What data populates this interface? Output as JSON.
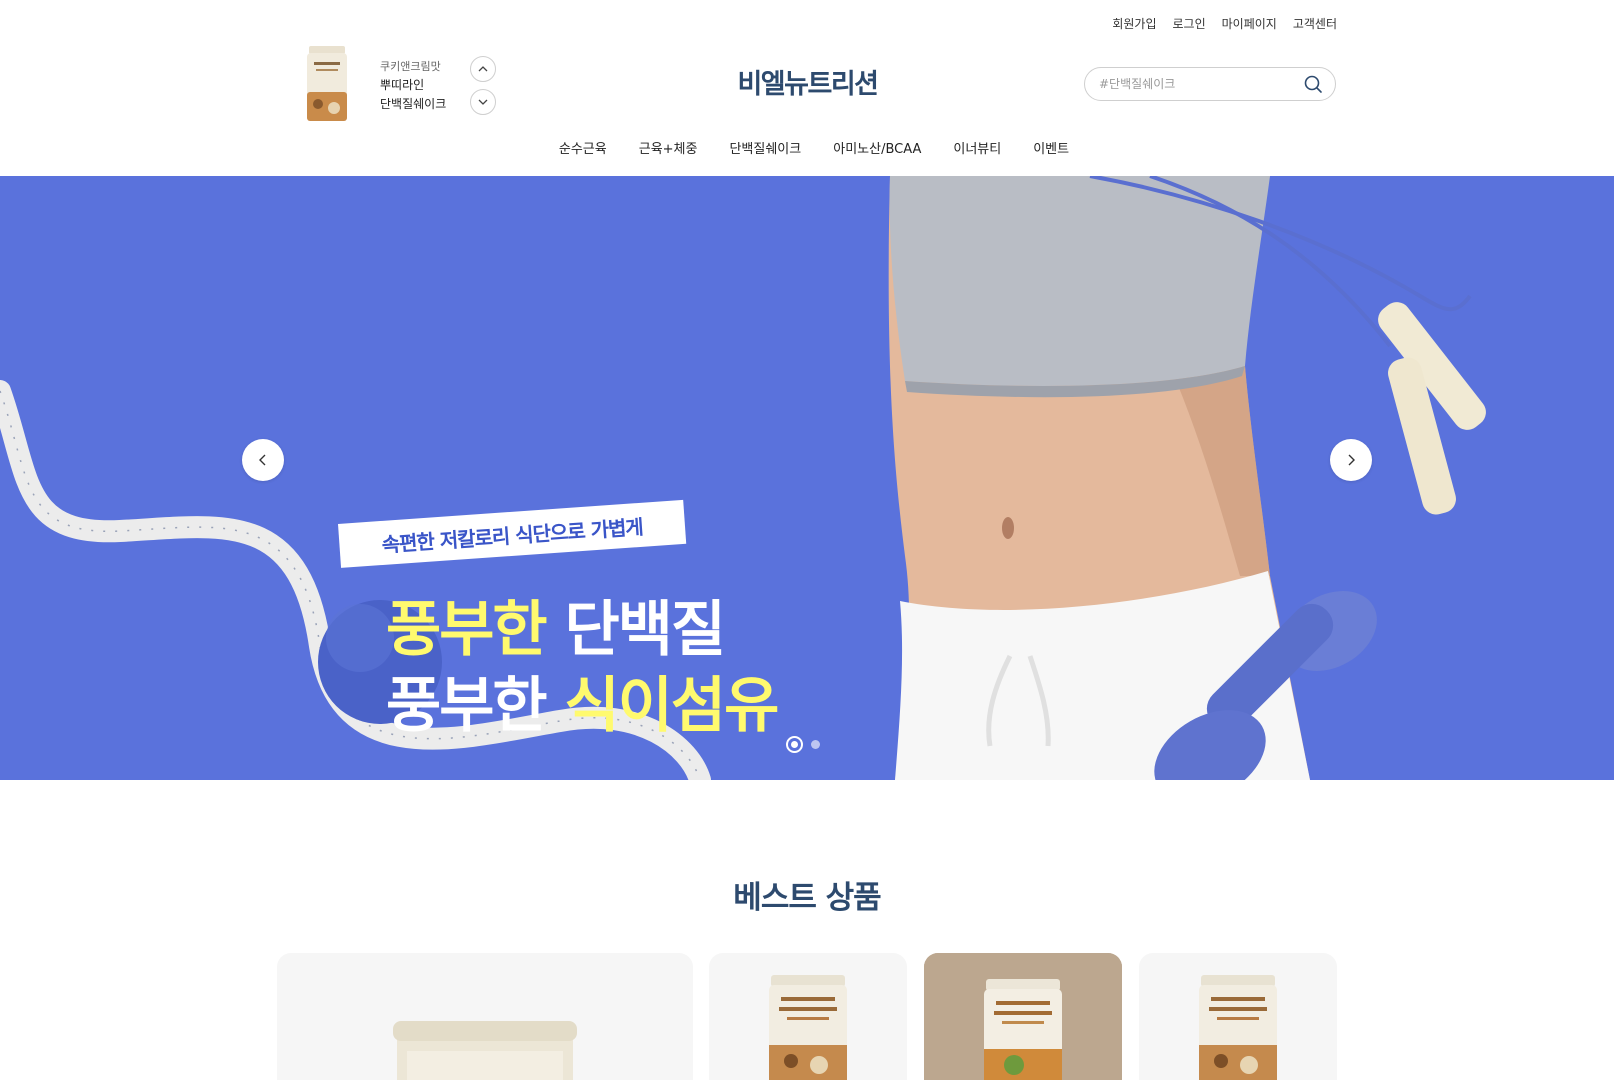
{
  "util_links": {
    "join": "회원가입",
    "login": "로그인",
    "mypage": "마이페이지",
    "cs": "고객센터"
  },
  "ticker": {
    "flavor": "쿠키앤크림맛",
    "name_line1": "뿌띠라인",
    "name_line2": "단백질쉐이크",
    "up_icon": "chevron-up-icon",
    "down_icon": "chevron-down-icon"
  },
  "brand": {
    "logo": "비엘뉴트리션",
    "color": "#2d4a6e"
  },
  "search": {
    "placeholder": "#단백질쉐이크",
    "value": "",
    "icon": "search-icon"
  },
  "gnb": [
    "순수근육",
    "근육+체중",
    "단백질쉐이크",
    "아미노산/BCAA",
    "이너뷰티",
    "이벤트"
  ],
  "hero": {
    "tag": "속편한 저칼로리 식단으로 가볍게",
    "line1_yellow": "풍부한",
    "line1_white": " 단백질",
    "line2_white": "풍부한 ",
    "line2_yellow": "식이섬유",
    "background": "#5a72dc",
    "accent": "#fffa6e",
    "slide_count": 2,
    "active_slide": 1
  },
  "best": {
    "title": "베스트 상품"
  }
}
